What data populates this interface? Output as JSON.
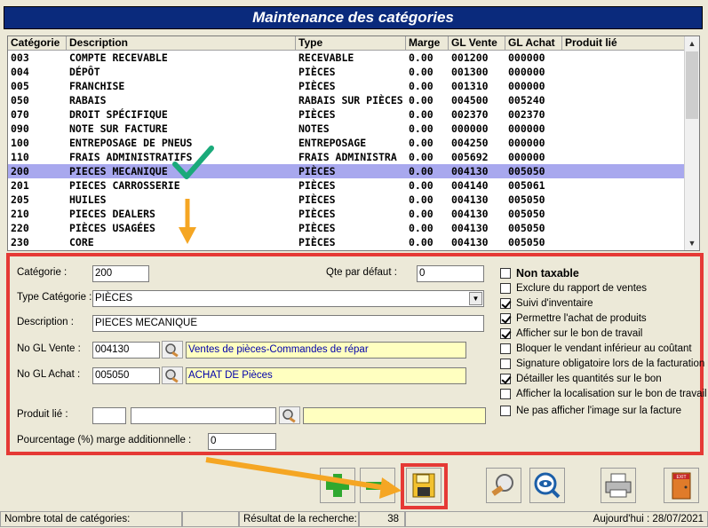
{
  "window": {
    "title": "Maintenance des catégories"
  },
  "grid": {
    "headers": [
      "Catégorie",
      "Description",
      "Type",
      "Marge",
      "GL Vente",
      "GL Achat",
      "Produit lié"
    ],
    "rows": [
      {
        "cat": "003",
        "desc": "COMPTE RECEVABLE",
        "type": "RECEVABLE",
        "marge": "0.00",
        "glv": "001200",
        "gla": "000000",
        "prod": ""
      },
      {
        "cat": "004",
        "desc": "DÉPÔT",
        "type": "PIÈCES",
        "marge": "0.00",
        "glv": "001300",
        "gla": "000000",
        "prod": ""
      },
      {
        "cat": "005",
        "desc": "FRANCHISE",
        "type": "PIÈCES",
        "marge": "0.00",
        "glv": "001310",
        "gla": "000000",
        "prod": ""
      },
      {
        "cat": "050",
        "desc": "RABAIS",
        "type": "RABAIS SUR PIÈCES",
        "marge": "0.00",
        "glv": "004500",
        "gla": "005240",
        "prod": ""
      },
      {
        "cat": "070",
        "desc": "DROIT SPÉCIFIQUE",
        "type": "PIÈCES",
        "marge": "0.00",
        "glv": "002370",
        "gla": "002370",
        "prod": ""
      },
      {
        "cat": "090",
        "desc": "NOTE SUR FACTURE",
        "type": "NOTES",
        "marge": "0.00",
        "glv": "000000",
        "gla": "000000",
        "prod": ""
      },
      {
        "cat": "100",
        "desc": "ENTREPOSAGE DE PNEUS",
        "type": "ENTREPOSAGE",
        "marge": "0.00",
        "glv": "004250",
        "gla": "000000",
        "prod": ""
      },
      {
        "cat": "110",
        "desc": "FRAIS ADMINISTRATIFS",
        "type": "FRAIS ADMINISTRA",
        "marge": "0.00",
        "glv": "005692",
        "gla": "000000",
        "prod": ""
      },
      {
        "cat": "200",
        "desc": "PIECES MECANIQUE",
        "type": "PIÈCES",
        "marge": "0.00",
        "glv": "004130",
        "gla": "005050",
        "prod": ""
      },
      {
        "cat": "201",
        "desc": "PIECES CARROSSERIE",
        "type": "PIÈCES",
        "marge": "0.00",
        "glv": "004140",
        "gla": "005061",
        "prod": ""
      },
      {
        "cat": "205",
        "desc": "HUILES",
        "type": "PIÈCES",
        "marge": "0.00",
        "glv": "004130",
        "gla": "005050",
        "prod": ""
      },
      {
        "cat": "210",
        "desc": "PIECES DEALERS",
        "type": "PIÈCES",
        "marge": "0.00",
        "glv": "004130",
        "gla": "005050",
        "prod": ""
      },
      {
        "cat": "220",
        "desc": "PIÈCES USAGÉES",
        "type": "PIÈCES",
        "marge": "0.00",
        "glv": "004130",
        "gla": "005050",
        "prod": ""
      },
      {
        "cat": "230",
        "desc": "CORE",
        "type": "PIÈCES",
        "marge": "0.00",
        "glv": "004130",
        "gla": "005050",
        "prod": ""
      }
    ],
    "selected_row": "200"
  },
  "form": {
    "categorie_label": "Catégorie :",
    "categorie_value": "200",
    "qte_label": "Qte par défaut :",
    "qte_value": "0",
    "type_label": "Type Catégorie :",
    "type_value": "PIÈCES",
    "description_label": "Description :",
    "description_value": "PIECES MECANIQUE",
    "gl_vente_label": "No GL Vente :",
    "gl_vente_value": "004130",
    "gl_vente_desc": "Ventes de pièces-Commandes de répar",
    "gl_achat_label": "No GL Achat :",
    "gl_achat_value": "005050",
    "gl_achat_desc": "ACHAT DE Pièces",
    "produit_label": "Produit lié :",
    "produit_value": "",
    "produit_desc": "",
    "produit_extra": "",
    "pourcentage_label": "Pourcentage (%) marge additionnelle :",
    "pourcentage_value": "0"
  },
  "options": [
    {
      "label": "Non taxable",
      "checked": false
    },
    {
      "label": "Exclure du rapport de ventes",
      "checked": false
    },
    {
      "label": "Suivi d'inventaire",
      "checked": true
    },
    {
      "label": "Permettre l'achat de produits",
      "checked": true
    },
    {
      "label": "Afficher sur le bon de travail",
      "checked": true
    },
    {
      "label": "Bloquer le vendant inférieur au coûtant",
      "checked": false
    },
    {
      "label": "Signature obligatoire lors de la facturation",
      "checked": false
    },
    {
      "label": "Détailler les quantités sur le bon",
      "checked": true
    },
    {
      "label": "Afficher la localisation sur le bon de travail",
      "checked": false
    },
    {
      "label": "Ne pas afficher l'image sur la facture",
      "checked": false
    }
  ],
  "toolbar": {
    "add_icon": "plus-icon",
    "remove_icon": "minus-icon",
    "save_icon": "floppy-disk-icon",
    "search_icon": "magnifier-icon",
    "view_icon": "eye-magnifier-icon",
    "print_icon": "printer-icon",
    "exit_icon": "exit-door-icon",
    "exit_text": "EXIT"
  },
  "status": {
    "total_label": "Nombre total de catégories:",
    "total_value": "",
    "result_label": "Résultat de la recherche:",
    "result_value": "38",
    "date_label": "Aujourd'hui : 28/07/2021"
  },
  "colors": {
    "title_bg": "#0a2a7c",
    "highlight": "#e53935",
    "selection": "#a8a8ee",
    "arrow": "#f5a623",
    "check": "#1aaa7a"
  }
}
